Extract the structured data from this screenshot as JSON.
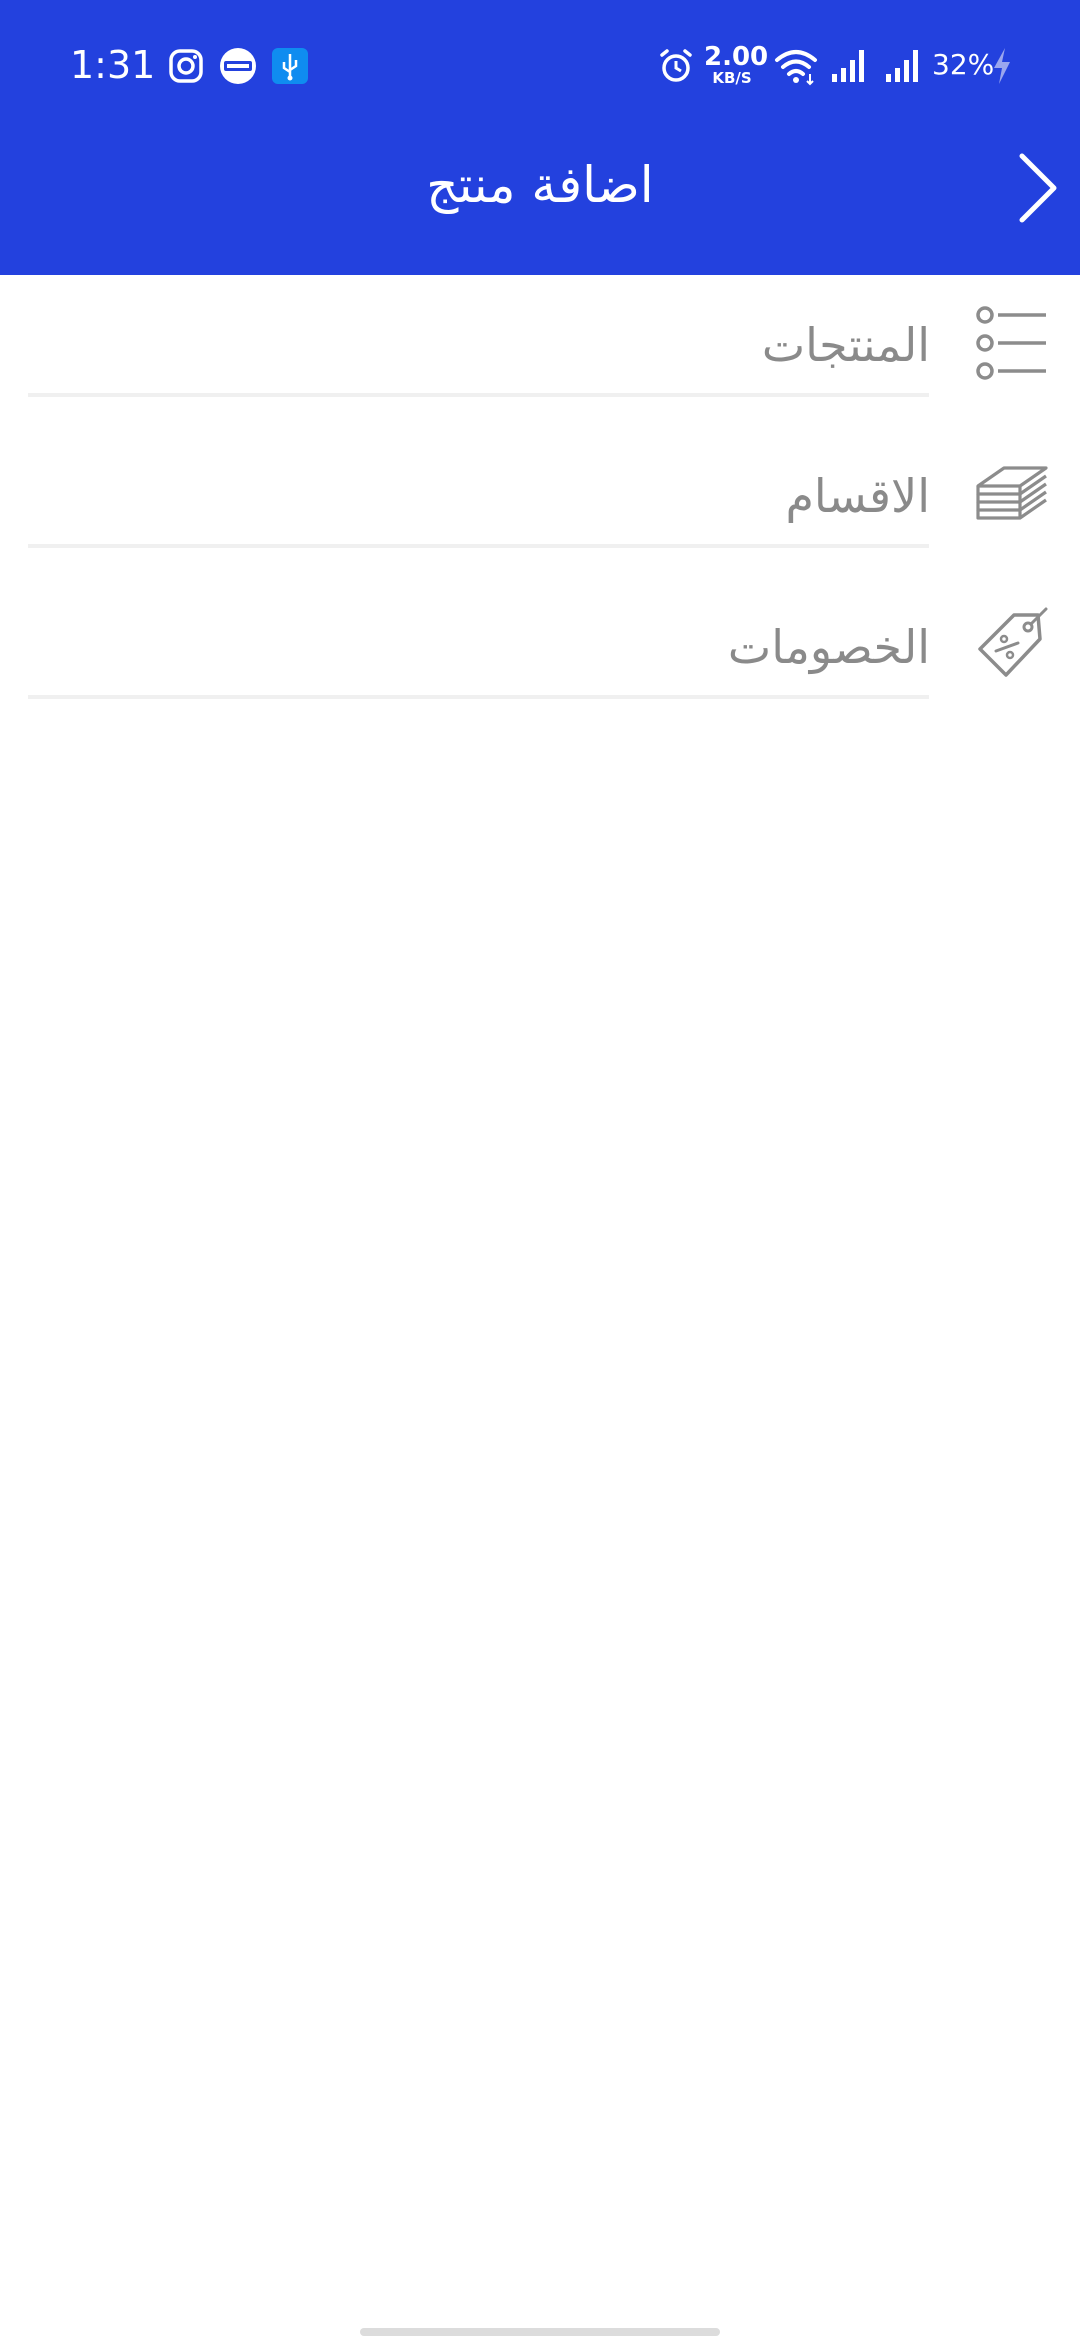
{
  "status_bar": {
    "time": "1:31",
    "net_speed_value": "2.00",
    "net_speed_unit": "KB/S",
    "battery": "32%",
    "icons": [
      "instagram-icon",
      "365-app-icon",
      "usb-icon",
      "alarm-icon",
      "wifi-icon",
      "signal-icon",
      "signal-icon",
      "charging-icon"
    ]
  },
  "app_bar": {
    "title": "اضافة منتج",
    "back_icon": "chevron-right-icon"
  },
  "menu": {
    "items": [
      {
        "label": "المنتجات",
        "icon": "list-icon"
      },
      {
        "label": "الاقسام",
        "icon": "layers-icon"
      },
      {
        "label": "الخصومات",
        "icon": "discount-tag-icon"
      }
    ]
  },
  "colors": {
    "primary": "#2341de",
    "text_muted": "#8a8a8a",
    "icon": "#8c8c8c",
    "divider": "#f0f0f0"
  }
}
